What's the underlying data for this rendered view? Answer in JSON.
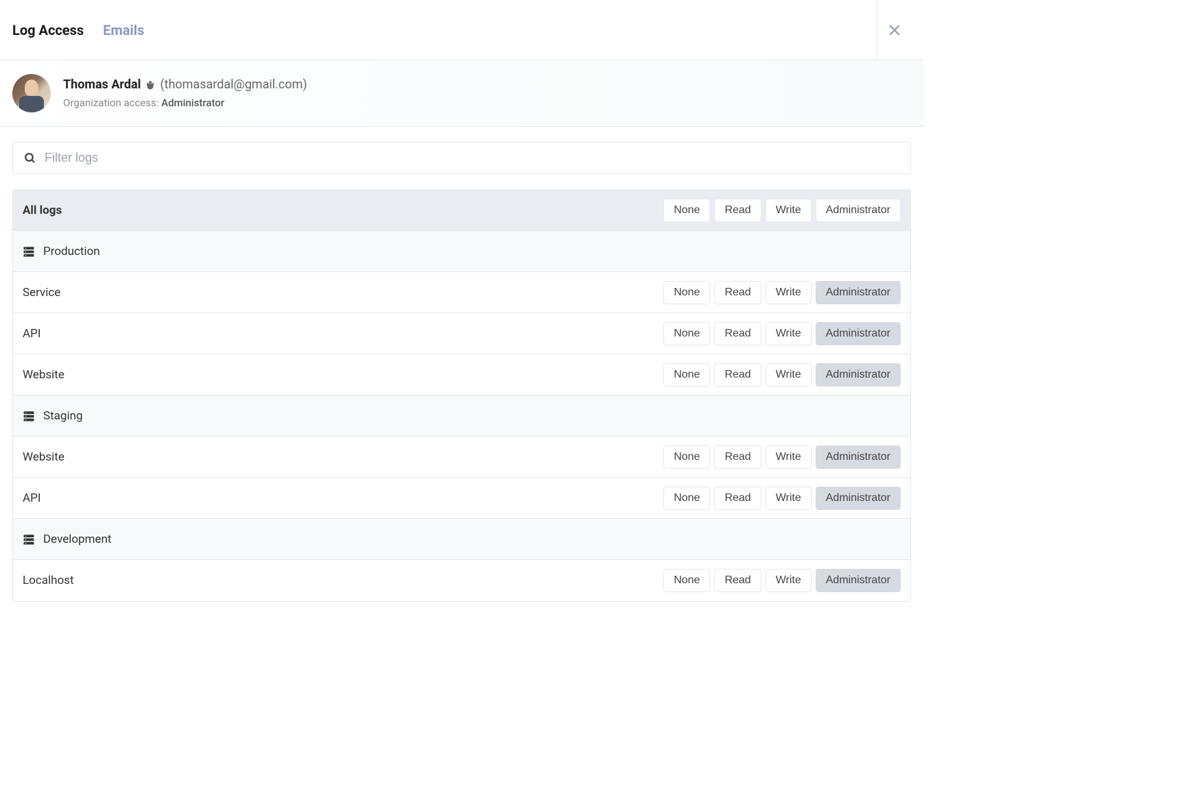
{
  "tabs": {
    "log_access": "Log Access",
    "emails": "Emails"
  },
  "user": {
    "name": "Thomas Ardal",
    "email_open": "(",
    "email": "thomasardal@gmail.com",
    "email_close": ")",
    "org_access_label": "Organization access: ",
    "org_access_value": "Administrator"
  },
  "filter": {
    "placeholder": "Filter logs"
  },
  "header_row": {
    "label": "All logs",
    "buttons": [
      "None",
      "Read",
      "Write",
      "Administrator"
    ],
    "selected": null
  },
  "groups": [
    {
      "name": "Production",
      "items": [
        {
          "name": "Service",
          "buttons": [
            "None",
            "Read",
            "Write",
            "Administrator"
          ],
          "selected": "Administrator"
        },
        {
          "name": "API",
          "buttons": [
            "None",
            "Read",
            "Write",
            "Administrator"
          ],
          "selected": "Administrator"
        },
        {
          "name": "Website",
          "buttons": [
            "None",
            "Read",
            "Write",
            "Administrator"
          ],
          "selected": "Administrator"
        }
      ]
    },
    {
      "name": "Staging",
      "items": [
        {
          "name": "Website",
          "buttons": [
            "None",
            "Read",
            "Write",
            "Administrator"
          ],
          "selected": "Administrator"
        },
        {
          "name": "API",
          "buttons": [
            "None",
            "Read",
            "Write",
            "Administrator"
          ],
          "selected": "Administrator"
        }
      ]
    },
    {
      "name": "Development",
      "items": [
        {
          "name": "Localhost",
          "buttons": [
            "None",
            "Read",
            "Write",
            "Administrator"
          ],
          "selected": "Administrator"
        }
      ]
    }
  ]
}
